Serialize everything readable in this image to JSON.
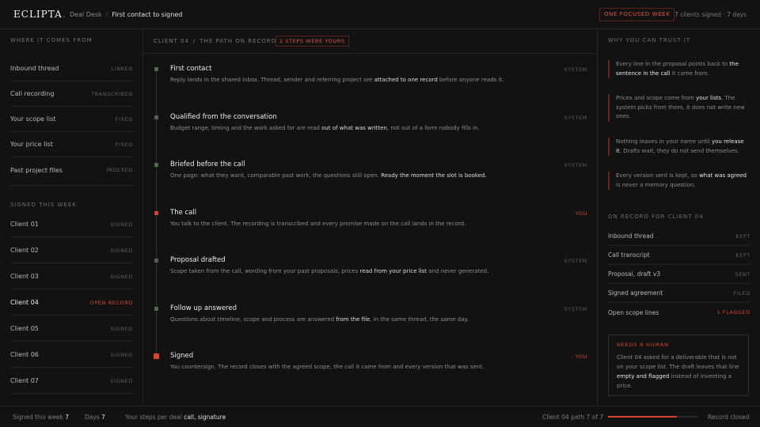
{
  "topbar": {
    "brand": "ECLIPTA",
    "brand_dot": ".",
    "crumb_parent": "Deal Desk",
    "crumb_sep": "/",
    "crumb_current": "First contact to signed",
    "focus_badge": "ONE FOCUSED WEEK",
    "meta": "7 clients signed · 7 days"
  },
  "left": {
    "sources_label": "WHERE IT COMES FROM",
    "sources": [
      {
        "name": "Inbound thread",
        "status": "LINKED"
      },
      {
        "name": "Call recording",
        "status": "TRANSCRIBED"
      },
      {
        "name": "Your scope list",
        "status": "FIXED"
      },
      {
        "name": "Your price list",
        "status": "FIXED"
      },
      {
        "name": "Past project files",
        "status": "INDEXED"
      }
    ],
    "signed_label": "SIGNED THIS WEEK",
    "clients": [
      {
        "name": "Client 01",
        "status": "SIGNED"
      },
      {
        "name": "Client 02",
        "status": "SIGNED"
      },
      {
        "name": "Client 03",
        "status": "SIGNED"
      },
      {
        "name": "Client 04",
        "status": "OPEN RECORD"
      },
      {
        "name": "Client 05",
        "status": "SIGNED"
      },
      {
        "name": "Client 06",
        "status": "SIGNED"
      },
      {
        "name": "Client 07",
        "status": "SIGNED"
      }
    ]
  },
  "middle": {
    "path_client": "CLIENT 04",
    "path_sep": "/",
    "path_title": "THE PATH ON RECORD",
    "steps_badge": "2 STEPS WERE YOURS",
    "steps": [
      {
        "title": "First contact",
        "who": "SYSTEM",
        "desc_a": "Reply lands in the shared inbox. Thread, sender and referring project are ",
        "desc_b": "attached to one record",
        "desc_c": " before anyone reads it."
      },
      {
        "title": "Qualified from the conversation",
        "who": "SYSTEM",
        "desc_a": "Budget range, timing and the work asked for are read ",
        "desc_b": "out of what was written",
        "desc_c": ", not out of a form nobody fills in."
      },
      {
        "title": "Briefed before the call",
        "who": "SYSTEM",
        "desc_a": "One page: what they want, comparable past work, the questions still open. ",
        "desc_b": "Ready the moment the slot is booked.",
        "desc_c": ""
      },
      {
        "title": "The call",
        "who": "YOU",
        "desc_a": "You talk to the client. The recording is transcribed and every promise made on the call lands in the record.",
        "desc_b": "",
        "desc_c": ""
      },
      {
        "title": "Proposal drafted",
        "who": "SYSTEM",
        "desc_a": "Scope taken from the call, wording from your past proposals, prices ",
        "desc_b": "read from your price list",
        "desc_c": " and never generated."
      },
      {
        "title": "Follow up answered",
        "who": "SYSTEM",
        "desc_a": "Questions about timeline, scope and process are answered ",
        "desc_b": "from the file",
        "desc_c": ", in the same thread, the same day."
      },
      {
        "title": "Signed",
        "who": "YOU",
        "desc_a": "You countersign. The record closes with the agreed scope, the call it came from and every version that was sent.",
        "desc_b": "",
        "desc_c": ""
      }
    ]
  },
  "right": {
    "trust_label": "WHY YOU CAN TRUST IT",
    "trust": [
      {
        "a": "Every line in the proposal points back to ",
        "b": "the sentence in the call",
        "c": " it came from."
      },
      {
        "a": "Prices and scope come from ",
        "b": "your lists",
        "c": ". The system picks from them, it does not write new ones."
      },
      {
        "a": "Nothing leaves in your name until ",
        "b": "you release it",
        "c": ". Drafts wait, they do not send themselves."
      },
      {
        "a": "Every version sent is kept, so ",
        "b": "what was agreed",
        "c": " is never a memory question."
      }
    ],
    "record_label": "ON RECORD FOR CLIENT 04",
    "records": [
      {
        "name": "Inbound thread",
        "status": "KEPT"
      },
      {
        "name": "Call transcript",
        "status": "KEPT"
      },
      {
        "name": "Proposal, draft v3",
        "status": "SENT"
      },
      {
        "name": "Signed agreement",
        "status": "FILED"
      },
      {
        "name": "Open scope lines",
        "status": "1 FLAGGED"
      }
    ],
    "human_label": "NEEDS A HUMAN",
    "human_a": "Client 04 asked for a deliverable that is not on your scope list. The draft leaves that line ",
    "human_b": "empty and flagged",
    "human_c": " instead of inventing a price."
  },
  "bottombar": {
    "signed_label": "Signed this week",
    "signed_value": "7",
    "days_label": "Days",
    "days_value": "7",
    "steps_label": "Your steps per deal",
    "steps_value": "call, signature",
    "path_label": "Client 04 path",
    "path_value": "7 of 7",
    "progress": 0.77,
    "closed_label": "Record closed"
  },
  "colors": {
    "accent": "#d8432e",
    "system_marker": "#4e6b4a",
    "background": "#121212"
  }
}
